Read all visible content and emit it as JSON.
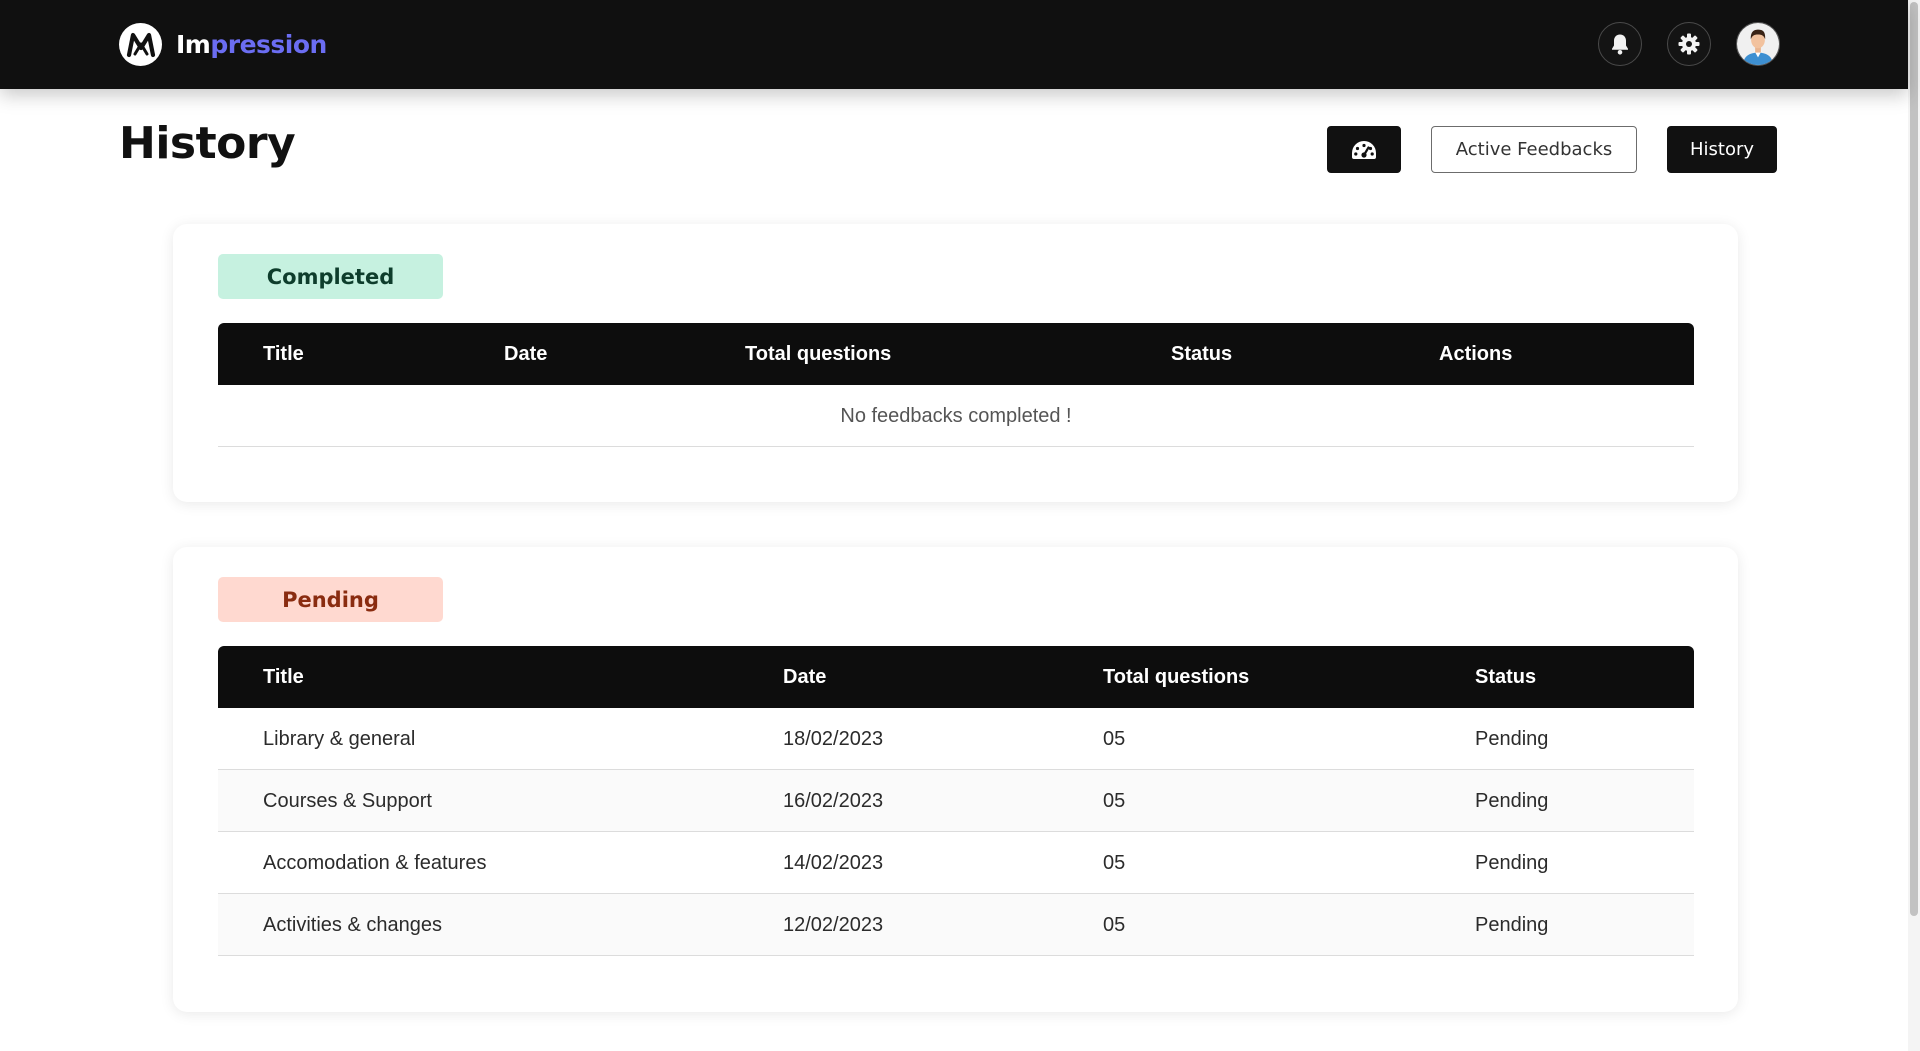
{
  "app": {
    "name_part1": "Im",
    "name_part2": "pression",
    "logo_icon": "brand-logo-icon",
    "brand_color": "#6b6df2"
  },
  "header_icons": [
    "bell-icon",
    "gear-icon",
    "user-avatar"
  ],
  "page": {
    "title": "History"
  },
  "actions": {
    "dashboard_icon": "speedometer-icon",
    "active_feedbacks_label": "Active Feedbacks",
    "history_label": "History"
  },
  "completed": {
    "badge": "Completed",
    "badge_color": "#c6f1e0",
    "columns": [
      "Title",
      "Date",
      "Total questions",
      "Status",
      "Actions"
    ],
    "empty_message": "No feedbacks completed !"
  },
  "pending": {
    "badge": "Pending",
    "badge_color": "#ffd9d0",
    "columns": [
      "Title",
      "Date",
      "Total questions",
      "Status"
    ],
    "rows": [
      {
        "title": "Library & general",
        "date": "18/02/2023",
        "total": "05",
        "status": "Pending"
      },
      {
        "title": "Courses & Support",
        "date": "16/02/2023",
        "total": "05",
        "status": "Pending"
      },
      {
        "title": "Accomodation & features",
        "date": "14/02/2023",
        "total": "05",
        "status": "Pending"
      },
      {
        "title": "Activities & changes",
        "date": "12/02/2023",
        "total": "05",
        "status": "Pending"
      }
    ]
  }
}
